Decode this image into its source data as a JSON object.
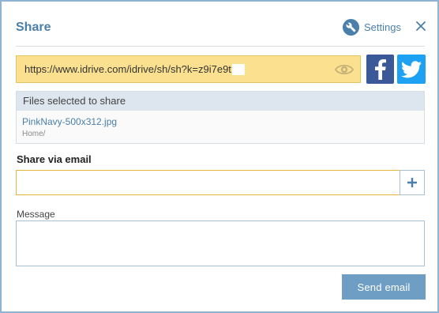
{
  "dialog": {
    "title": "Share",
    "settings_label": "Settings",
    "settings_icon": "wrench-icon",
    "close_icon": "close-icon"
  },
  "share_link": {
    "url": "https://www.idrive.com/idrive/sh/sh?k=z9i7e9t",
    "field_color": "#fbe18f",
    "visibility_icon": "eye-icon"
  },
  "social": {
    "facebook_icon": "facebook-icon",
    "facebook_color": "#3b5998",
    "twitter_icon": "twitter-icon",
    "twitter_color": "#1da1f2"
  },
  "files": {
    "header": "Files selected to share",
    "items": [
      {
        "name": "PinkNavy-500x312.jpg",
        "path": "Home/"
      }
    ]
  },
  "email": {
    "label": "Share via email",
    "value": "",
    "placeholder": "",
    "add_icon": "plus-icon"
  },
  "message": {
    "label": "Message",
    "value": ""
  },
  "actions": {
    "send_label": "Send email",
    "accent_color": "#6e9ec4"
  }
}
